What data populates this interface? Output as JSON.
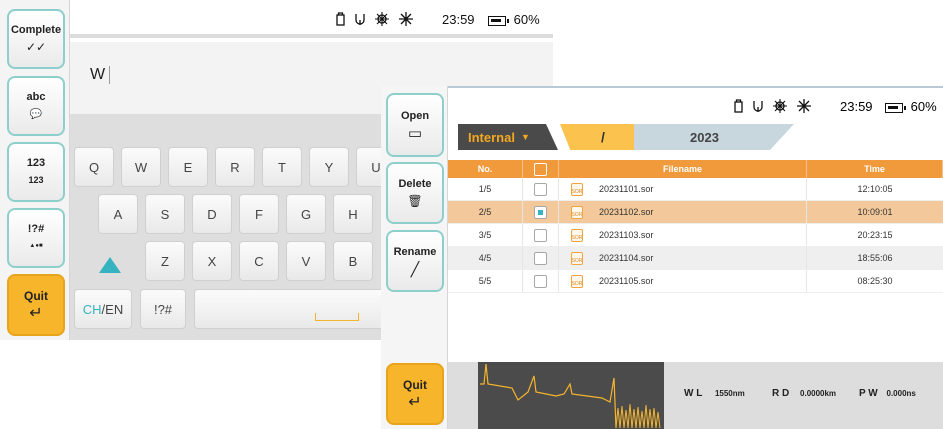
{
  "keyboard_screen": {
    "sidebar": {
      "complete": {
        "label": "Complete",
        "icon": "double-check-icon",
        "glyph": "✓✓"
      },
      "abc": {
        "label": "abc",
        "icon": "chat-icon",
        "glyph": "💬"
      },
      "num": {
        "label": "123",
        "icon": "numeric-icon",
        "glyph": "123"
      },
      "sym": {
        "label": "!?#",
        "icon": "shapes-icon",
        "glyph": "▲●■"
      },
      "quit": {
        "label": "Quit",
        "icon": "return-arrow-icon",
        "glyph": "↵"
      }
    },
    "status": {
      "time": "23:59",
      "battery": "60%"
    },
    "input": {
      "value": "W"
    },
    "keys": {
      "row1": [
        "Q",
        "W",
        "E",
        "R",
        "T",
        "Y",
        "U"
      ],
      "row2": [
        "A",
        "S",
        "D",
        "F",
        "G",
        "H"
      ],
      "row3": [
        "Z",
        "X",
        "C",
        "V",
        "B"
      ],
      "lang_ch": "CH",
      "lang_en": "/EN",
      "symbols": "!?#"
    }
  },
  "file_screen": {
    "sidebar": {
      "open": {
        "label": "Open",
        "icon": "folder-open-icon",
        "glyph": "▭"
      },
      "delete": {
        "label": "Delete",
        "icon": "trash-icon",
        "glyph": "🗑"
      },
      "rename": {
        "label": "Rename",
        "icon": "pencil-icon",
        "glyph": "╱"
      },
      "quit": {
        "label": "Quit",
        "icon": "return-arrow-icon",
        "glyph": "↵"
      }
    },
    "status": {
      "time": "23:59",
      "battery": "60%"
    },
    "breadcrumb": {
      "storage": "Internal",
      "separator": "/",
      "folder": "2023"
    },
    "table": {
      "headers": {
        "no": "No.",
        "filename": "Filename",
        "time": "Time"
      },
      "rows": [
        {
          "no": "1/5",
          "filename": "20231101.sor",
          "time": "12:10:05",
          "checked": false
        },
        {
          "no": "2/5",
          "filename": "20231102.sor",
          "time": "10:09:01",
          "checked": true
        },
        {
          "no": "3/5",
          "filename": "20231103.sor",
          "time": "20:23:15",
          "checked": false
        },
        {
          "no": "4/5",
          "filename": "20231104.sor",
          "time": "18:55:06",
          "checked": false
        },
        {
          "no": "5/5",
          "filename": "20231105.sor",
          "time": "08:25:30",
          "checked": false
        }
      ],
      "file_icon_text": "SOR"
    },
    "measurements": {
      "wl_label": "W L",
      "wl_value": "1550nm",
      "rd_label": "R D",
      "rd_value": "0.0000km",
      "pw_label": "P W",
      "pw_value": "0.000ns"
    }
  },
  "colors": {
    "accent_teal": "#36b3c0",
    "accent_orange": "#f19a3b",
    "quit_yellow": "#f7b52c",
    "selected_row": "#f3c89a"
  }
}
